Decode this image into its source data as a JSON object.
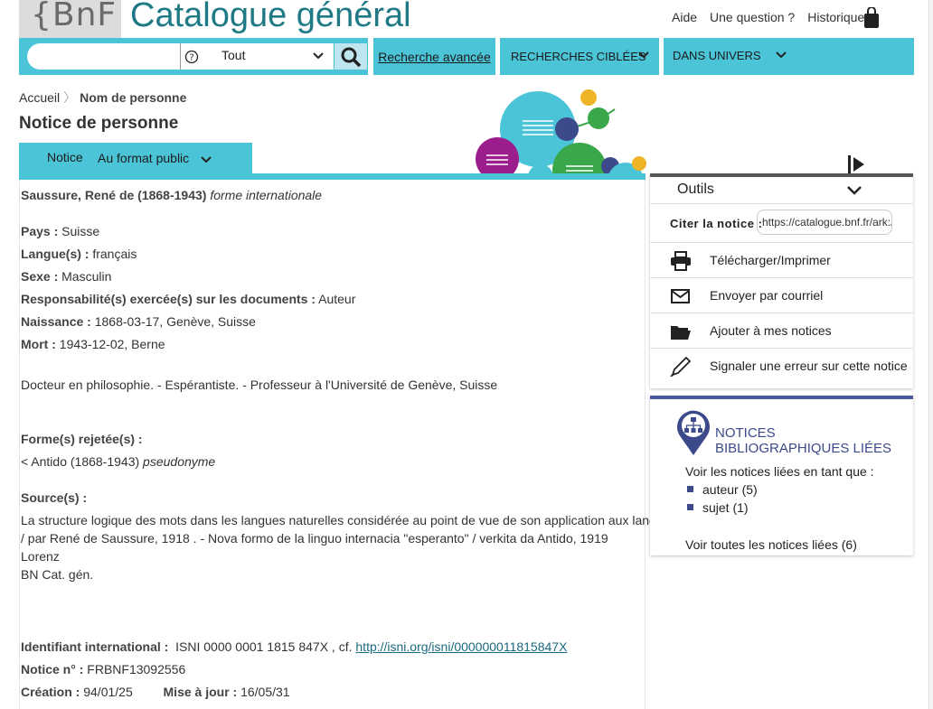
{
  "header": {
    "logo": "BnF",
    "title": "Catalogue général",
    "links": [
      "Aide",
      "Une question ?",
      "Historique"
    ],
    "bag_icon": "shopping-bag-icon"
  },
  "search": {
    "placeholder": "",
    "scope": "Tout",
    "help_icon": "question-circle-icon",
    "search_icon": "search-icon"
  },
  "nav": {
    "advanced": "Recherche avancée",
    "targeted": "RECHERCHES CIBLÉES",
    "universes": "DANS UNIVERS"
  },
  "breadcrumb": {
    "home": "Accueil",
    "current": "Nom de personne"
  },
  "page_title": "Notice de personne",
  "notice_tab": {
    "label": "Notice",
    "format": "Au format public"
  },
  "record": {
    "name": "Saussure, René de (1868-1943)",
    "name_form": "forme internationale",
    "fields": [
      {
        "label": "Pays :",
        "value": "Suisse"
      },
      {
        "label": "Langue(s) :",
        "value": "français"
      },
      {
        "label": "Sexe :",
        "value": "Masculin"
      },
      {
        "label": "Responsabilité(s) exercée(s) sur les documents :",
        "value": "Auteur"
      },
      {
        "label": "Naissance :",
        "value": "1868-03-17, Genève, Suisse"
      },
      {
        "label": "Mort :",
        "value": "1943-12-02, Berne"
      }
    ],
    "note": "Docteur en philosophie. - Espérantiste. - Professeur à l'Université de Genève, Suisse",
    "rejected_label": "Forme(s) rejetée(s) :",
    "rejected_value": "< Antido (1868-1943)",
    "rejected_form": "pseudonyme",
    "sources_label": "Source(s) :",
    "sources_line1": "La structure logique des mots dans les langues naturelles considérée au point de vue de son application aux langues artificielles",
    "sources_line2": "/ par René de Saussure, 1918 . - Nova formo de la linguo internacia \"esperanto\" / verkita da Antido, 1919",
    "sources_line3": "Lorenz",
    "sources_line4": "BN Cat. gén.",
    "intl_id_label": "Identifiant international :",
    "intl_id_value": "ISNI 0000 0001 1815 847X , cf.",
    "intl_id_link": "http://isni.org/isni/000000011815847X",
    "notice_no_label": "Notice n° :",
    "notice_no_value": "FRBNF13092556",
    "creation_label": "Création :",
    "creation_value": "94/01/25",
    "update_label": "Mise à jour :",
    "update_value": "16/05/31"
  },
  "tools": {
    "title": "Outils",
    "cite_label": "Citer la notice :",
    "cite_value": "https://catalogue.bnf.fr/ark:/",
    "items": [
      {
        "label": "Télécharger/Imprimer",
        "icon": "printer-icon"
      },
      {
        "label": "Envoyer par courriel",
        "icon": "envelope-icon"
      },
      {
        "label": "Ajouter à mes notices",
        "icon": "folder-icon"
      },
      {
        "label": "Signaler une erreur sur cette notice",
        "icon": "pencil-icon"
      }
    ]
  },
  "linked": {
    "title": "NOTICES BIBLIOGRAPHIQUES LIÉES",
    "intro": "Voir les notices liées en tant que :",
    "items": [
      "auteur (5)",
      "sujet (1)"
    ],
    "all": "Voir toutes les notices liées (6)"
  },
  "colors": {
    "accent": "#4cc4d8",
    "brand": "#1f7a86",
    "linked_accent": "#3c4a8c"
  }
}
